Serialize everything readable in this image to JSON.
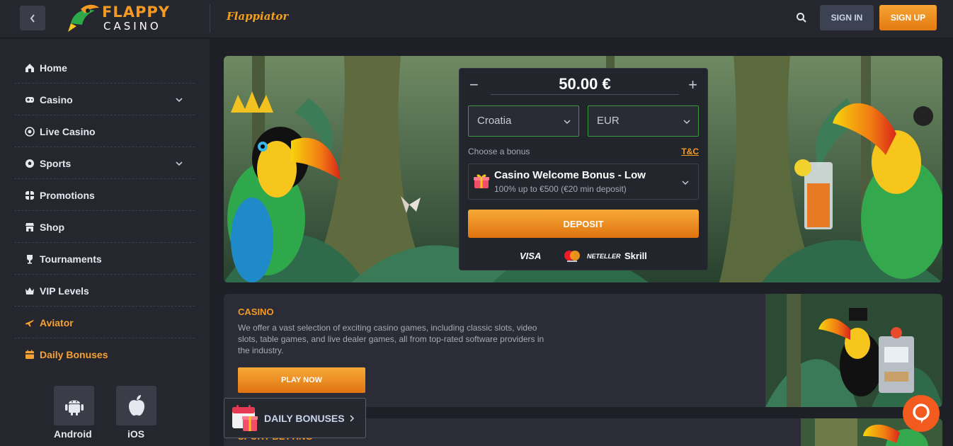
{
  "header": {
    "logo_top": "FLAPPY",
    "logo_bottom": "CASINO",
    "game_logo": "Flappiator",
    "signin_label": "SIGN IN",
    "signup_label": "SIGN UP",
    "icons": {
      "back": "chevron-left-icon",
      "search": "search-icon"
    }
  },
  "sidebar": {
    "items": [
      {
        "label": "Home",
        "icon": "home-icon",
        "has_chevron": false,
        "highlight": false
      },
      {
        "label": "Casino",
        "icon": "gamepad-icon",
        "has_chevron": true,
        "highlight": false
      },
      {
        "label": "Live Casino",
        "icon": "live-casino-icon",
        "has_chevron": false,
        "highlight": false
      },
      {
        "label": "Sports",
        "icon": "soccer-ball-icon",
        "has_chevron": true,
        "highlight": false
      },
      {
        "label": "Promotions",
        "icon": "promotions-icon",
        "has_chevron": false,
        "highlight": false
      },
      {
        "label": "Shop",
        "icon": "shop-icon",
        "has_chevron": false,
        "highlight": false
      },
      {
        "label": "Tournaments",
        "icon": "trophy-icon",
        "has_chevron": false,
        "highlight": false
      },
      {
        "label": "VIP Levels",
        "icon": "crown-icon",
        "has_chevron": false,
        "highlight": false
      },
      {
        "label": "Aviator",
        "icon": "plane-icon",
        "has_chevron": false,
        "highlight": true
      },
      {
        "label": "Daily Bonuses",
        "icon": "calendar-icon",
        "has_chevron": false,
        "highlight": true
      }
    ],
    "apps": [
      {
        "label": "Android",
        "icon": "android-icon"
      },
      {
        "label": "iOS",
        "icon": "apple-icon"
      }
    ]
  },
  "deposit": {
    "amount": "50.00 €",
    "minus": "−",
    "plus": "+",
    "country": "Croatia",
    "currency": "EUR",
    "bonus_label": "Choose a bonus",
    "tc_label": "T&C",
    "bonus_title": "Casino Welcome Bonus - Low",
    "bonus_sub": "100% up to €500 (€20 min deposit)",
    "deposit_label": "DEPOSIT",
    "payments": [
      "VISA",
      "NETELLER",
      "Skrill"
    ]
  },
  "casino_section": {
    "title": "CASINO",
    "description": "We offer a vast selection of exciting casino games, including classic slots, video slots, table games, and live dealer games, all from top-rated software providers in the industry.",
    "button_label": "PLAY NOW"
  },
  "sports_section": {
    "title": "SPORT BETTING"
  },
  "daily_float": {
    "label": "DAILY BONUSES"
  },
  "colors": {
    "accent": "#f39a24",
    "background": "#1f2027",
    "panel": "#25262e",
    "chat": "#f25a1e"
  }
}
